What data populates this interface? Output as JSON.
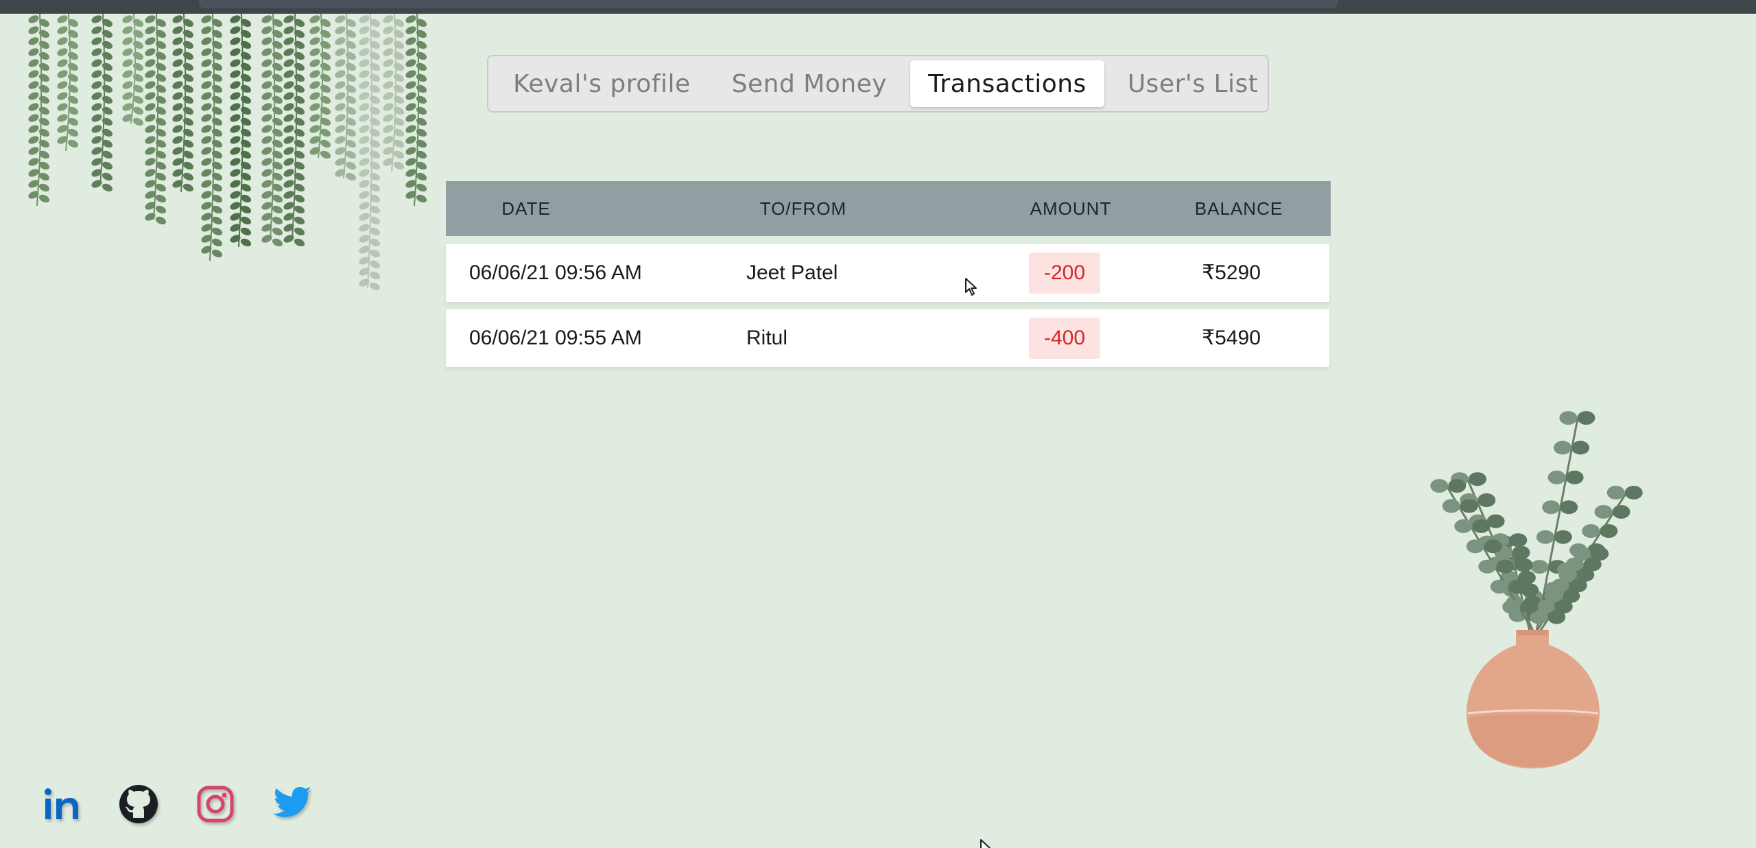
{
  "nav": {
    "tabs": [
      {
        "label": "Keval's profile",
        "active": false
      },
      {
        "label": "Send Money",
        "active": false
      },
      {
        "label": "Transactions",
        "active": true
      },
      {
        "label": "User's List",
        "active": false
      }
    ]
  },
  "table": {
    "headers": {
      "date": "DATE",
      "to_from": "TO/FROM",
      "amount": "AMOUNT",
      "balance": "BALANCE"
    },
    "rows": [
      {
        "date": "06/06/21 09:56 AM",
        "to_from": "Jeet Patel",
        "amount": "-200",
        "balance": "₹5290"
      },
      {
        "date": "06/06/21 09:55 AM",
        "to_from": "Ritul",
        "amount": "-400",
        "balance": "₹5490"
      }
    ]
  },
  "socials": [
    {
      "icon": "linkedin-icon",
      "color": "#0a66c2"
    },
    {
      "icon": "github-icon",
      "color": "#1b1f23"
    },
    {
      "icon": "instagram-icon",
      "color": "#d8436a"
    },
    {
      "icon": "twitter-icon",
      "color": "#1d9bf0"
    }
  ],
  "colors": {
    "background": "#e0ecdf",
    "header_bg": "#929fa2",
    "amount_negative": "#d62626",
    "amount_negative_bg": "#fde2e2"
  }
}
